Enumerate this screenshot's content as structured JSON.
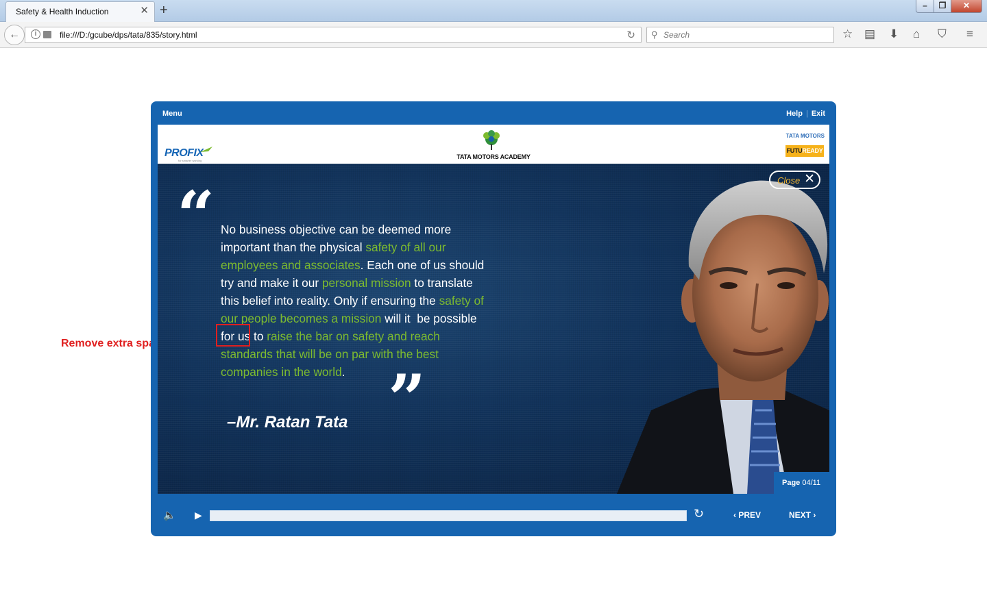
{
  "browser": {
    "tab_title": "Safety & Health Induction",
    "tab_close": "✕",
    "new_tab": "+",
    "url": "file:///D:/gcube/dps/tata/835/story.html",
    "search_placeholder": "Search",
    "toolbar_icons": [
      "star-icon",
      "reading-list-icon",
      "download-icon",
      "home-icon",
      "pocket-icon",
      "hamburger-menu-icon"
    ]
  },
  "annotation": {
    "text": "Remove extra space."
  },
  "player": {
    "menu": "Menu",
    "help": "Help",
    "separator": "|",
    "exit": "Exit",
    "header": {
      "profix": "PROFIX",
      "profix_tagline": "for smarter working",
      "academy": "TATA MOTORS ACADEMY",
      "tata_motors": "TATA MOTORS",
      "futuready_a": "FUTU",
      "futuready_b": "READY"
    },
    "close_label": "Close",
    "quote_open": "“",
    "quote_close": "”",
    "quote": {
      "p1": "No business objective can be deemed more important than the physical ",
      "h1": "safety of all our employees and associates",
      "p2": ". Each one of us should try and make it our ",
      "h2": "personal mission",
      "p3": " to translate this belief into reality. Only if ensuring the ",
      "h3": "safety of our people becomes a mission",
      "p4": " will it  be possible for us to ",
      "h4": "raise the bar on safety and reach standards that will be on par with the best companies in the world",
      "p5": "."
    },
    "author": "–Mr. Ratan Tata",
    "page_word": "Page",
    "page_num": "04/11",
    "progress": 1.0,
    "prev": "PREV",
    "next": "NEXT",
    "colors": {
      "frame": "#1664b0",
      "highlight": "#7dbb2f",
      "close_text": "#f4b731",
      "annotation": "#e02020"
    }
  }
}
